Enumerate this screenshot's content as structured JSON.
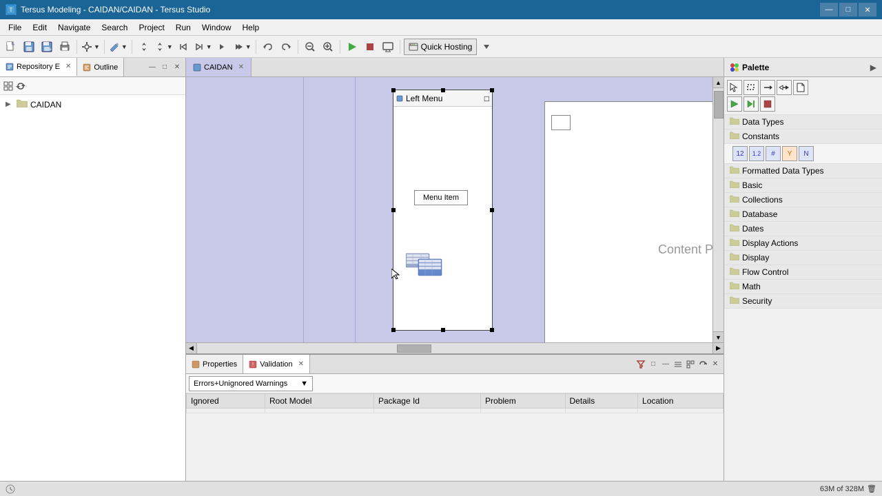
{
  "titlebar": {
    "title": "Tersus Modeling - CAIDAN/CAIDAN - Tersus Studio",
    "icon": "T",
    "minimize": "—",
    "maximize": "□",
    "close": "✕"
  },
  "menubar": {
    "items": [
      "File",
      "Edit",
      "Navigate",
      "Search",
      "Project",
      "Run",
      "Window",
      "Help"
    ]
  },
  "toolbar": {
    "quick_hosting": "Quick Hosting"
  },
  "left_panel": {
    "repo_tab": "Repository E",
    "outline_tab": "Outline",
    "tree": {
      "label": "CAIDAN"
    }
  },
  "editor": {
    "tab": "CAIDAN"
  },
  "canvas": {
    "left_menu_title": "Left Menu",
    "menu_item_label": "Menu Item",
    "content_pane_label": "Content Pane"
  },
  "palette": {
    "title": "Palette",
    "categories": [
      "Data Types",
      "Constants",
      "Formatted Data Types",
      "Basic",
      "Collections",
      "Database",
      "Dates",
      "Display Actions",
      "Display",
      "Flow Control",
      "Math",
      "Security"
    ],
    "tools": {
      "row1": [
        "↖",
        "⬜",
        "→",
        "→→",
        "📄"
      ],
      "row2": [
        "▶",
        "▶▶",
        "⏹"
      ]
    }
  },
  "bottom_panel": {
    "properties_tab": "Properties",
    "validation_tab": "Validation",
    "filter": "Errors+Unignored Warnings",
    "table_headers": [
      "Ignored",
      "Root Model",
      "Package Id",
      "Problem",
      "Details",
      "Location"
    ]
  },
  "statusbar": {
    "left": "",
    "memory": "63M of 328M",
    "icon": "🗑"
  }
}
